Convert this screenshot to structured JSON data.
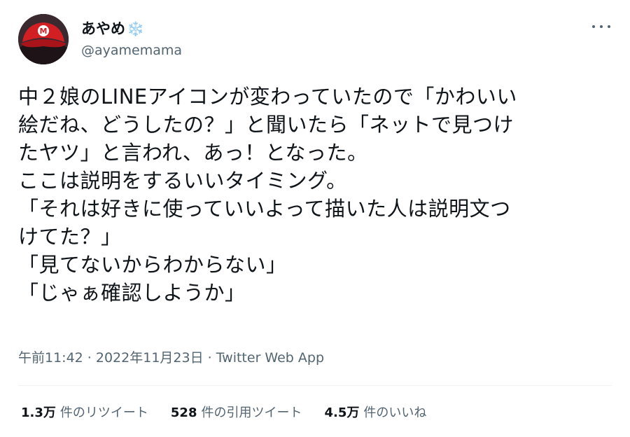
{
  "user": {
    "display_name": "あやめ",
    "name_emoji": "❄️",
    "handle": "@ayamemama",
    "avatar_icon": "red-cap-avatar-icon"
  },
  "tweet": {
    "lines": [
      "中２娘のLINEアイコンが変わっていたので「かわいい",
      "絵だね、どうしたの？」と聞いたら「ネットで見つけ",
      "たヤツ」と言われ、あっ！となった。",
      "ここは説明をするいいタイミング。",
      "「それは好きに使っていいよって描いた人は説明文つ",
      "けてた？」",
      "「見てないからわからない」",
      "「じゃぁ確認しようか」"
    ],
    "meta": "午前11:42 · 2022年11月23日 · Twitter Web App"
  },
  "stats": [
    {
      "value": "1.3万",
      "label": "件のリツイート"
    },
    {
      "value": "528",
      "label": "件の引用ツイート"
    },
    {
      "value": "4.5万",
      "label": "件のいいね"
    }
  ],
  "colors": {
    "text": "#0f1419",
    "secondary": "#536471",
    "divider": "#eff3f4",
    "avatar_cap": "#c81e1e"
  }
}
